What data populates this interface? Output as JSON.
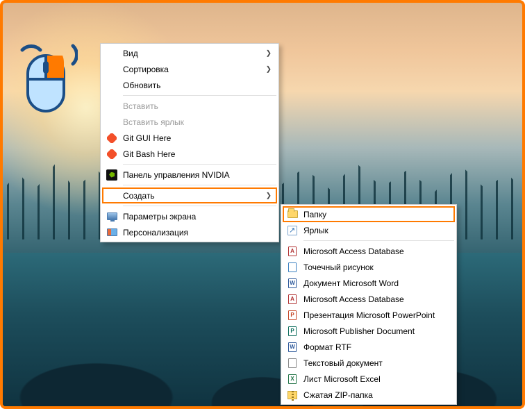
{
  "main_menu": {
    "view": {
      "label": "Вид",
      "has_submenu": true
    },
    "sort": {
      "label": "Сортировка",
      "has_submenu": true
    },
    "refresh": {
      "label": "Обновить"
    },
    "paste": {
      "label": "Вставить",
      "disabled": true
    },
    "paste_lnk": {
      "label": "Вставить ярлык",
      "disabled": true
    },
    "git_gui": {
      "label": "Git GUI Here"
    },
    "git_bash": {
      "label": "Git Bash Here"
    },
    "nvidia": {
      "label": "Панель управления NVIDIA"
    },
    "create": {
      "label": "Создать",
      "has_submenu": true,
      "highlighted": true
    },
    "display": {
      "label": "Параметры экрана"
    },
    "personal": {
      "label": "Персонализация"
    }
  },
  "sub_menu": {
    "folder": {
      "label": "Папку",
      "highlighted": true
    },
    "shortcut": {
      "label": "Ярлык"
    },
    "access1": {
      "label": "Microsoft Access Database",
      "badge": "A"
    },
    "bmp": {
      "label": "Точечный рисунок"
    },
    "word": {
      "label": "Документ Microsoft Word",
      "badge": "W"
    },
    "access2": {
      "label": "Microsoft Access Database",
      "badge": "A"
    },
    "ppt": {
      "label": "Презентация Microsoft PowerPoint",
      "badge": "P"
    },
    "pub": {
      "label": "Microsoft Publisher Document",
      "badge": "P"
    },
    "rtf": {
      "label": "Формат RTF",
      "badge": "W"
    },
    "txt": {
      "label": "Текстовый документ"
    },
    "xls": {
      "label": "Лист Microsoft Excel",
      "badge": "X"
    },
    "zip": {
      "label": "Сжатая ZIP-папка"
    }
  }
}
